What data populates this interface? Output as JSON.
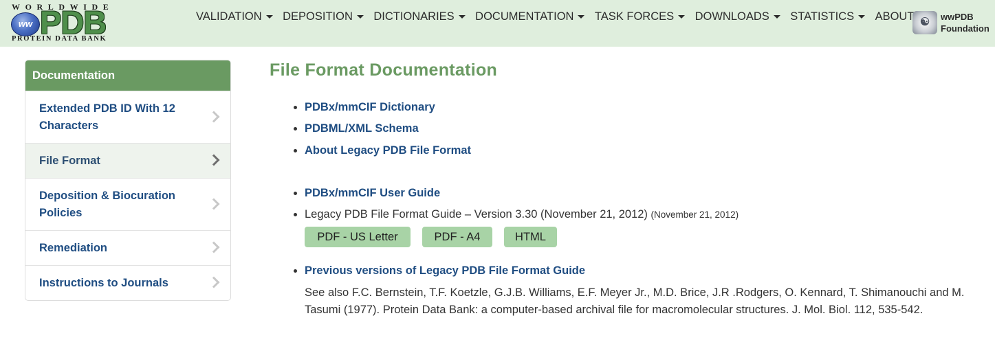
{
  "logo": {
    "top_text": "WORLDWIDE",
    "main_text": "PDB",
    "globe_text": "ww",
    "bottom_text": "PROTEIN DATA BANK"
  },
  "nav": {
    "items": [
      {
        "label": "VALIDATION"
      },
      {
        "label": "DEPOSITION"
      },
      {
        "label": "DICTIONARIES"
      },
      {
        "label": "DOCUMENTATION"
      },
      {
        "label": "TASK FORCES"
      },
      {
        "label": "DOWNLOADS"
      },
      {
        "label": "STATISTICS"
      },
      {
        "label": "ABOUT"
      }
    ]
  },
  "foundation": {
    "line1": "wwPDB",
    "line2": "Foundation"
  },
  "sidebar": {
    "title": "Documentation",
    "items": [
      {
        "label": "Extended PDB ID With 12 Characters"
      },
      {
        "label": "File Format"
      },
      {
        "label": "Deposition & Biocuration Policies"
      },
      {
        "label": "Remediation"
      },
      {
        "label": "Instructions to Journals"
      }
    ]
  },
  "main": {
    "title": "File Format Documentation",
    "links": {
      "dictionary": "PDBx/mmCIF Dictionary",
      "xml_schema": "PDBML/XML Schema",
      "legacy_about": "About Legacy PDB File Format",
      "user_guide": "PDBx/mmCIF User Guide",
      "previous_versions": "Previous versions of Legacy PDB File Format Guide"
    },
    "legacy_guide": {
      "text": "Legacy PDB File Format Guide – Version 3.30 (November 21, 2012)",
      "date": "(November 21, 2012)",
      "buttons": [
        "PDF - US Letter",
        "PDF - A4",
        "HTML"
      ]
    },
    "reference": "See also F.C. Bernstein, T.F. Koetzle, G.J.B. Williams, E.F. Meyer Jr., M.D. Brice, J.R .Rodgers, O. Kennard, T. Shimanouchi and M. Tasumi (1977). Protein Data Bank: a computer-based archival file for macromolecular structures. J. Mol. Biol. 112, 535-542."
  },
  "colors": {
    "topbar_bg": "#dfeedd",
    "sidebar_header": "#6a9a62",
    "link": "#1f4d82",
    "title": "#6a9a62",
    "button": "#a8d3a6"
  }
}
